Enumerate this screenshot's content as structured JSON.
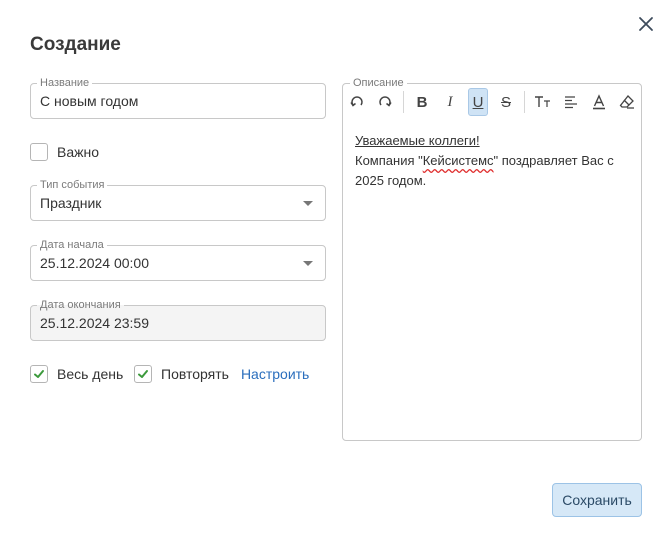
{
  "dialog": {
    "title": "Создание",
    "close_icon": "close-icon"
  },
  "form": {
    "name": {
      "label": "Название",
      "value": "С новым годом"
    },
    "important": {
      "label": "Важно",
      "checked": false
    },
    "event_type": {
      "label": "Тип события",
      "value": "Праздник"
    },
    "start_date": {
      "label": "Дата начала",
      "value": "25.12.2024 00:00"
    },
    "end_date": {
      "label": "Дата окончания",
      "value": "25.12.2024 23:59"
    },
    "all_day": {
      "label": "Весь день",
      "checked": true
    },
    "repeat": {
      "label": "Повторять",
      "checked": true
    },
    "configure_link": "Настроить"
  },
  "description": {
    "label": "Описание",
    "toolbar": [
      "undo-icon",
      "redo-icon",
      "bold-icon",
      "italic-icon",
      "underline-icon",
      "strikethrough-icon",
      "text-size-icon",
      "align-left-icon",
      "text-color-icon",
      "clear-format-icon"
    ],
    "active_tool": "underline-icon",
    "line1": "Уважаемые коллеги!",
    "line2_before": "Компания \"",
    "line2_spell": "Кейсистемс",
    "line2_after": "\" поздравляет Вас с 2025 годом."
  },
  "actions": {
    "save_label": "Сохранить"
  },
  "colors": {
    "accent": "#2a6ebd",
    "checkmark": "#3c9a3c",
    "save_bg": "#d6e8f7",
    "toolbar_active": "#cfe3f5"
  }
}
